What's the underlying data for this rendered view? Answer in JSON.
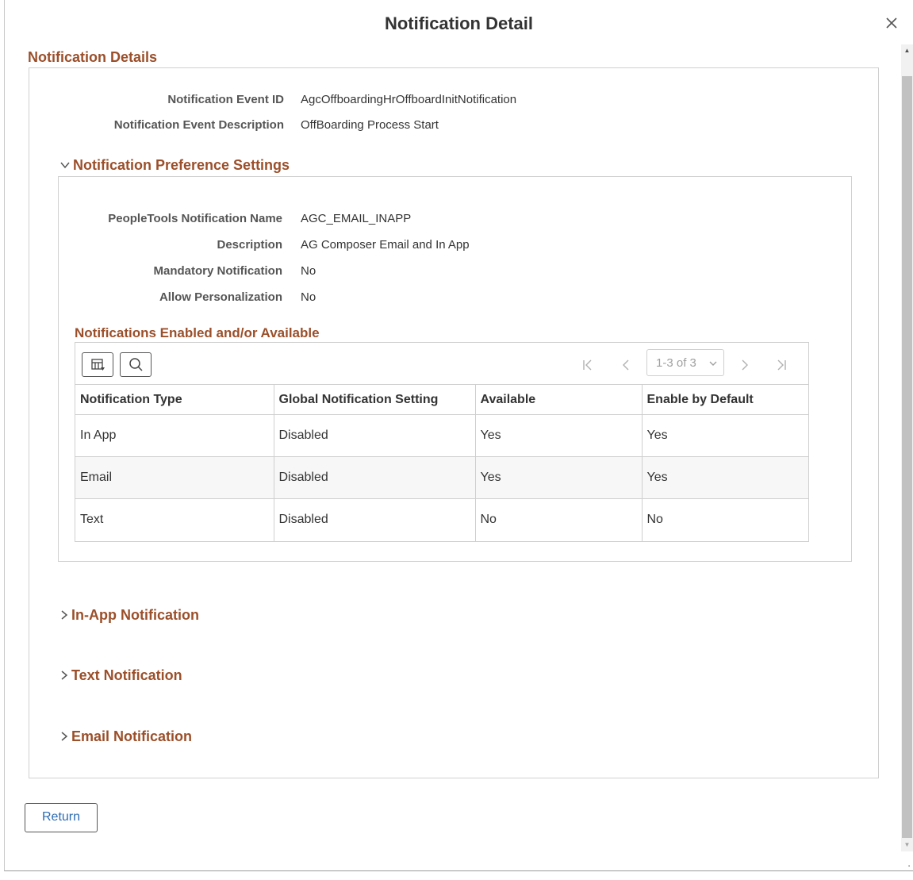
{
  "dialog": {
    "title": "Notification Detail"
  },
  "details": {
    "section_title": "Notification Details",
    "event_id_label": "Notification Event ID",
    "event_id_value": "AgcOffboardingHrOffboardInitNotification",
    "event_desc_label": "Notification Event Description",
    "event_desc_value": "OffBoarding Process Start"
  },
  "preferences": {
    "section_title": "Notification Preference Settings",
    "fields": [
      {
        "label": "PeopleTools Notification Name",
        "value": "AGC_EMAIL_INAPP"
      },
      {
        "label": "Description",
        "value": "AG Composer Email and In App"
      },
      {
        "label": "Mandatory Notification",
        "value": "No"
      },
      {
        "label": "Allow Personalization",
        "value": "No"
      }
    ]
  },
  "grid": {
    "title": "Notifications Enabled and/or Available",
    "pager_text": "1-3 of 3",
    "columns": [
      "Notification Type",
      "Global Notification Setting",
      "Available",
      "Enable by Default"
    ],
    "rows": [
      [
        "In App",
        "Disabled",
        "Yes",
        "Yes"
      ],
      [
        "Email",
        "Disabled",
        "Yes",
        "Yes"
      ],
      [
        "Text",
        "Disabled",
        "No",
        "No"
      ]
    ]
  },
  "collapsibles": {
    "in_app": "In-App Notification",
    "text": "Text Notification",
    "email": "Email Notification"
  },
  "footer": {
    "return_label": "Return"
  }
}
